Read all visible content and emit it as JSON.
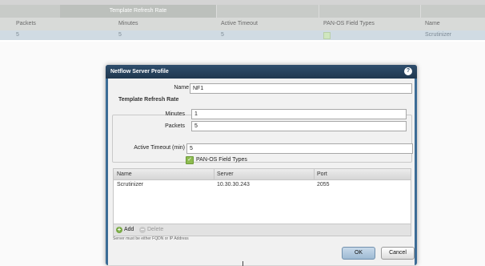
{
  "background_table": {
    "group_header": "Template Refresh Rate",
    "columns": [
      "Packets",
      "Minutes",
      "Active Timeout",
      "PAN-OS Field Types",
      "Name"
    ],
    "row": {
      "packets": "5",
      "minutes": "5",
      "active_timeout": "5",
      "pan_os_field_types": true,
      "name": "Scrutinizer"
    }
  },
  "dialog": {
    "title": "Netflow Server Profile",
    "help": "?",
    "name_label": "Name",
    "name_value": "NF1",
    "refresh_group_label": "Template Refresh Rate",
    "minutes_label": "Minutes",
    "minutes_value": "1",
    "packets_label": "Packets",
    "packets_value": "5",
    "active_timeout_label": "Active Timeout (min)",
    "active_timeout_value": "5",
    "pan_os_label": "PAN-OS Field Types",
    "pan_os_checked": true,
    "grid": {
      "columns": [
        "Name",
        "Server",
        "Port"
      ],
      "rows": [
        {
          "name": "Scrutinizer",
          "server": "10.30.30.243",
          "port": "2055"
        }
      ],
      "add_label": "Add",
      "delete_label": "Delete"
    },
    "hint": "Server must be either FQDN or IP Address",
    "ok_label": "OK",
    "cancel_label": "Cancel"
  },
  "colors": {
    "dialog_border": "#3c6c96",
    "title_bar": "#2e4d6c",
    "checkbox_green": "#8dbb50",
    "selected_row": "#d0dbe3"
  }
}
